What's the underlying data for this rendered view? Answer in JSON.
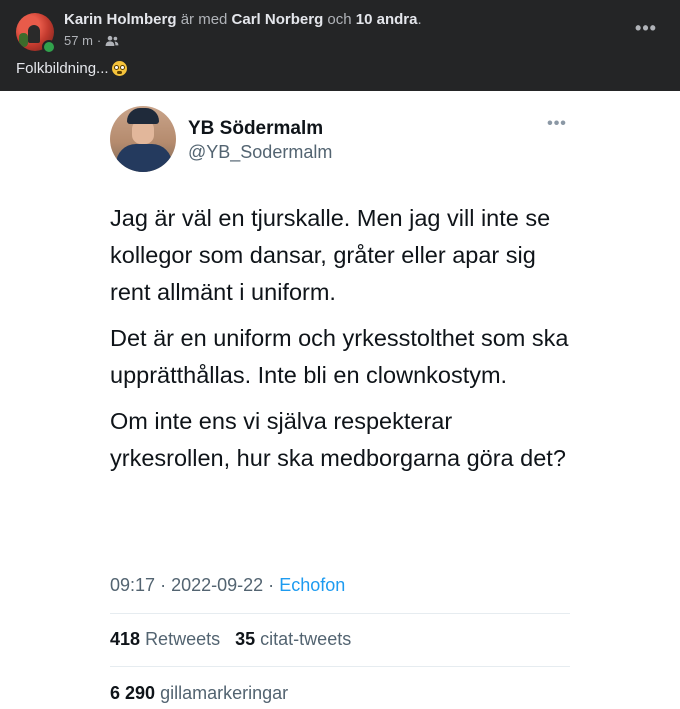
{
  "facebook_post": {
    "author": "Karin Holmberg",
    "with_text": "är med",
    "tagged_person": "Carl Norberg",
    "and_text": "och",
    "others": "10 andra",
    "period": ".",
    "time": "57 m",
    "separator": "·",
    "audience_icon": "friends-icon",
    "more_icon": "more-icon",
    "text": "Folkbildning...",
    "emoji": "flushed-face-emoji"
  },
  "tweet": {
    "display_name": "YB Södermalm",
    "handle": "@YB_Sodermalm",
    "more_icon": "more-icon",
    "paragraphs": [
      "Jag är väl en tjurskalle. Men jag vill inte se kollegor som dansar, gråter eller apar sig rent allmänt i uniform.",
      "Det är en uniform och yrkesstolthet som ska upprätthållas. Inte bli en clownkostym.",
      "Om inte ens vi själva respekterar yrkesrollen, hur ska medborgarna göra det?"
    ],
    "time": "09:17",
    "date": "2022-09-22",
    "dot1": "·",
    "dot2": "·",
    "source": "Echofon",
    "retweets_count": "418",
    "retweets_label": "Retweets",
    "quotes_count": "35",
    "quotes_label": "citat-tweets",
    "likes_count": "6 290",
    "likes_label": "gillamarkeringar"
  },
  "colors": {
    "fb_background": "#242526",
    "fb_text": "#e4e6eb",
    "fb_secondary": "#b0b3b8",
    "online": "#31a24c",
    "tweet_text": "#0f1419",
    "tweet_secondary": "#536471",
    "link": "#1d9bf0"
  }
}
